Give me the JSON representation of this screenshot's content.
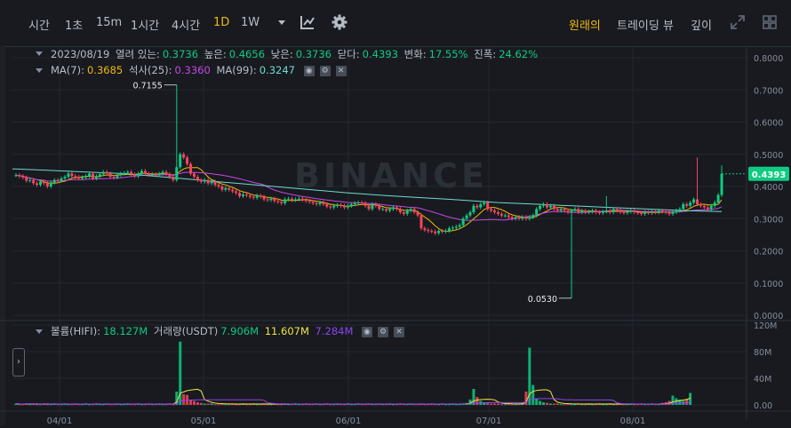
{
  "toolbar": {
    "intervals": [
      "시간",
      "1초",
      "15m",
      "1시간",
      "4시간",
      "1D",
      "1W"
    ],
    "active_interval": "1D",
    "views": [
      "원래의",
      "트레이딩 뷰",
      "깊이"
    ],
    "active_view": "원래의",
    "icons": [
      "chevron-down-icon",
      "indicator-icon",
      "settings-gear-icon",
      "expand-icon",
      "grid-layout-icon"
    ]
  },
  "ohlc_legend": {
    "date": "2023/08/19",
    "open_label": "열려 있는:",
    "open": "0.3736",
    "high_label": "높은:",
    "high": "0.4656",
    "low_label": "낮은:",
    "low": "0.3736",
    "close_label": "닫다:",
    "close": "0.4393",
    "change_label": "변화:",
    "change": "17.55%",
    "amplitude_label": "진폭:",
    "amplitude": "24.62%"
  },
  "ma_legend": {
    "ma7_label": "MA(7):",
    "ma7": "0.3685",
    "ma25_label": "석사(25):",
    "ma25": "0.3360",
    "ma99_label": "MA(99):",
    "ma99": "0.3247"
  },
  "volume_legend": {
    "vol_label": "볼륨(HIFI):",
    "vol": "18.127M",
    "quote_label": "거래량(USDT)",
    "quote": "7.906M",
    "ma1": "11.607M",
    "ma2": "7.284M"
  },
  "colors": {
    "up": "#0ecb81",
    "down": "#f6465d",
    "ma7": "#f0b90b",
    "ma25": "#c848e6",
    "ma99": "#6fdbcf",
    "vol_ma1": "#f0e442",
    "vol_ma2": "#8e44ef",
    "background": "#181a20",
    "grid": "#23272e",
    "accent": "#f0b90b"
  },
  "watermark": "BINANCE",
  "chart_data": {
    "type": "candlestick",
    "price_axis": {
      "ticks": [
        "0.8000",
        "0.7000",
        "0.6000",
        "0.5000",
        "0.4000",
        "0.3000",
        "0.2000",
        "0.1000",
        "0.0000"
      ],
      "ylim": [
        0,
        0.8
      ]
    },
    "volume_axis": {
      "ticks": [
        "120M",
        "80M",
        "40M",
        "0.00"
      ],
      "ylim": [
        0,
        120
      ]
    },
    "x_ticks": [
      "04/01",
      "05/01",
      "06/01",
      "07/01",
      "08/01"
    ],
    "current_price": "0.4393",
    "annotations": {
      "high": "0.7155",
      "low": "0.0530"
    },
    "price_series": [
      0.435,
      0.432,
      0.428,
      0.418,
      0.42,
      0.41,
      0.405,
      0.415,
      0.41,
      0.4,
      0.412,
      0.42,
      0.418,
      0.425,
      0.43,
      0.44,
      0.432,
      0.43,
      0.425,
      0.428,
      0.432,
      0.44,
      0.425,
      0.432,
      0.438,
      0.445,
      0.44,
      0.43,
      0.428,
      0.435,
      0.44,
      0.442,
      0.445,
      0.438,
      0.432,
      0.44,
      0.448,
      0.44,
      0.436,
      0.438,
      0.435,
      0.44,
      0.445,
      0.438,
      0.43,
      0.42,
      0.46,
      0.5,
      0.49,
      0.47,
      0.44,
      0.43,
      0.42,
      0.415,
      0.42,
      0.41,
      0.415,
      0.405,
      0.4,
      0.39,
      0.395,
      0.39,
      0.385,
      0.38,
      0.37,
      0.375,
      0.372,
      0.368,
      0.365,
      0.372,
      0.368,
      0.36,
      0.358,
      0.362,
      0.355,
      0.352,
      0.348,
      0.36,
      0.362,
      0.358,
      0.36,
      0.362,
      0.358,
      0.355,
      0.352,
      0.348,
      0.345,
      0.35,
      0.345,
      0.338,
      0.335,
      0.34,
      0.342,
      0.34,
      0.335,
      0.34,
      0.345,
      0.348,
      0.35,
      0.348,
      0.34,
      0.33,
      0.345,
      0.34,
      0.33,
      0.33,
      0.325,
      0.33,
      0.335,
      0.33,
      0.32,
      0.315,
      0.325,
      0.33,
      0.32,
      0.31,
      0.27,
      0.265,
      0.262,
      0.26,
      0.255,
      0.262,
      0.26,
      0.262,
      0.27,
      0.272,
      0.275,
      0.28,
      0.3,
      0.31,
      0.32,
      0.34,
      0.335,
      0.345,
      0.35,
      0.33,
      0.325,
      0.32,
      0.315,
      0.31,
      0.31,
      0.305,
      0.3,
      0.305,
      0.3,
      0.305,
      0.3,
      0.305,
      0.31,
      0.33,
      0.34,
      0.345,
      0.335,
      0.34,
      0.33,
      0.325,
      0.33,
      0.325,
      0.32,
      0.325,
      0.33,
      0.32,
      0.325,
      0.32,
      0.322,
      0.325,
      0.32,
      0.318,
      0.322,
      0.325,
      0.32,
      0.33,
      0.325,
      0.32,
      0.318,
      0.322,
      0.325,
      0.32,
      0.318,
      0.315,
      0.32,
      0.318,
      0.322,
      0.32,
      0.325,
      0.322,
      0.32,
      0.315,
      0.32,
      0.325,
      0.33,
      0.345,
      0.34,
      0.35,
      0.36,
      0.345,
      0.34,
      0.335,
      0.33,
      0.34,
      0.35,
      0.3736,
      0.4393
    ],
    "ma99_series": [
      0.455,
      0.45,
      0.445,
      0.44,
      0.43,
      0.42,
      0.41,
      0.4,
      0.39,
      0.38,
      0.372,
      0.365,
      0.358,
      0.35,
      0.345,
      0.34,
      0.335,
      0.33,
      0.325,
      0.322
    ],
    "volume_series_millions": [
      2,
      1,
      1,
      2,
      1,
      2,
      1,
      1,
      2,
      1,
      1,
      2,
      1,
      1,
      2,
      1,
      1,
      2,
      1,
      1,
      2,
      1,
      1,
      2,
      1,
      1,
      2,
      1,
      1,
      2,
      1,
      1,
      2,
      1,
      1,
      2,
      1,
      1,
      2,
      1,
      1,
      2,
      1,
      1,
      2,
      1,
      20,
      95,
      16,
      15,
      8,
      6,
      4,
      3,
      2,
      2,
      2,
      1,
      1,
      2,
      1,
      1,
      2,
      1,
      1,
      2,
      1,
      1,
      2,
      1,
      1,
      2,
      1,
      1,
      2,
      1,
      1,
      2,
      1,
      1,
      2,
      1,
      1,
      2,
      1,
      1,
      2,
      1,
      1,
      2,
      1,
      1,
      2,
      1,
      1,
      2,
      1,
      1,
      2,
      1,
      1,
      2,
      1,
      1,
      2,
      1,
      1,
      2,
      1,
      1,
      2,
      1,
      1,
      2,
      1,
      1,
      2,
      1,
      1,
      2,
      1,
      1,
      2,
      1,
      1,
      2,
      1,
      1,
      2,
      3,
      8,
      24,
      12,
      6,
      4,
      3,
      2,
      2,
      2,
      1,
      1,
      2,
      1,
      1,
      2,
      3,
      20,
      86,
      30,
      10,
      6,
      4,
      3,
      2,
      2,
      2,
      1,
      1,
      2,
      1,
      1,
      2,
      1,
      1,
      2,
      1,
      1,
      2,
      1,
      1,
      2,
      1,
      1,
      2,
      1,
      1,
      2,
      1,
      1,
      2,
      1,
      1,
      2,
      1,
      1,
      3,
      4,
      6,
      14,
      10,
      8,
      6,
      9,
      18
    ]
  }
}
